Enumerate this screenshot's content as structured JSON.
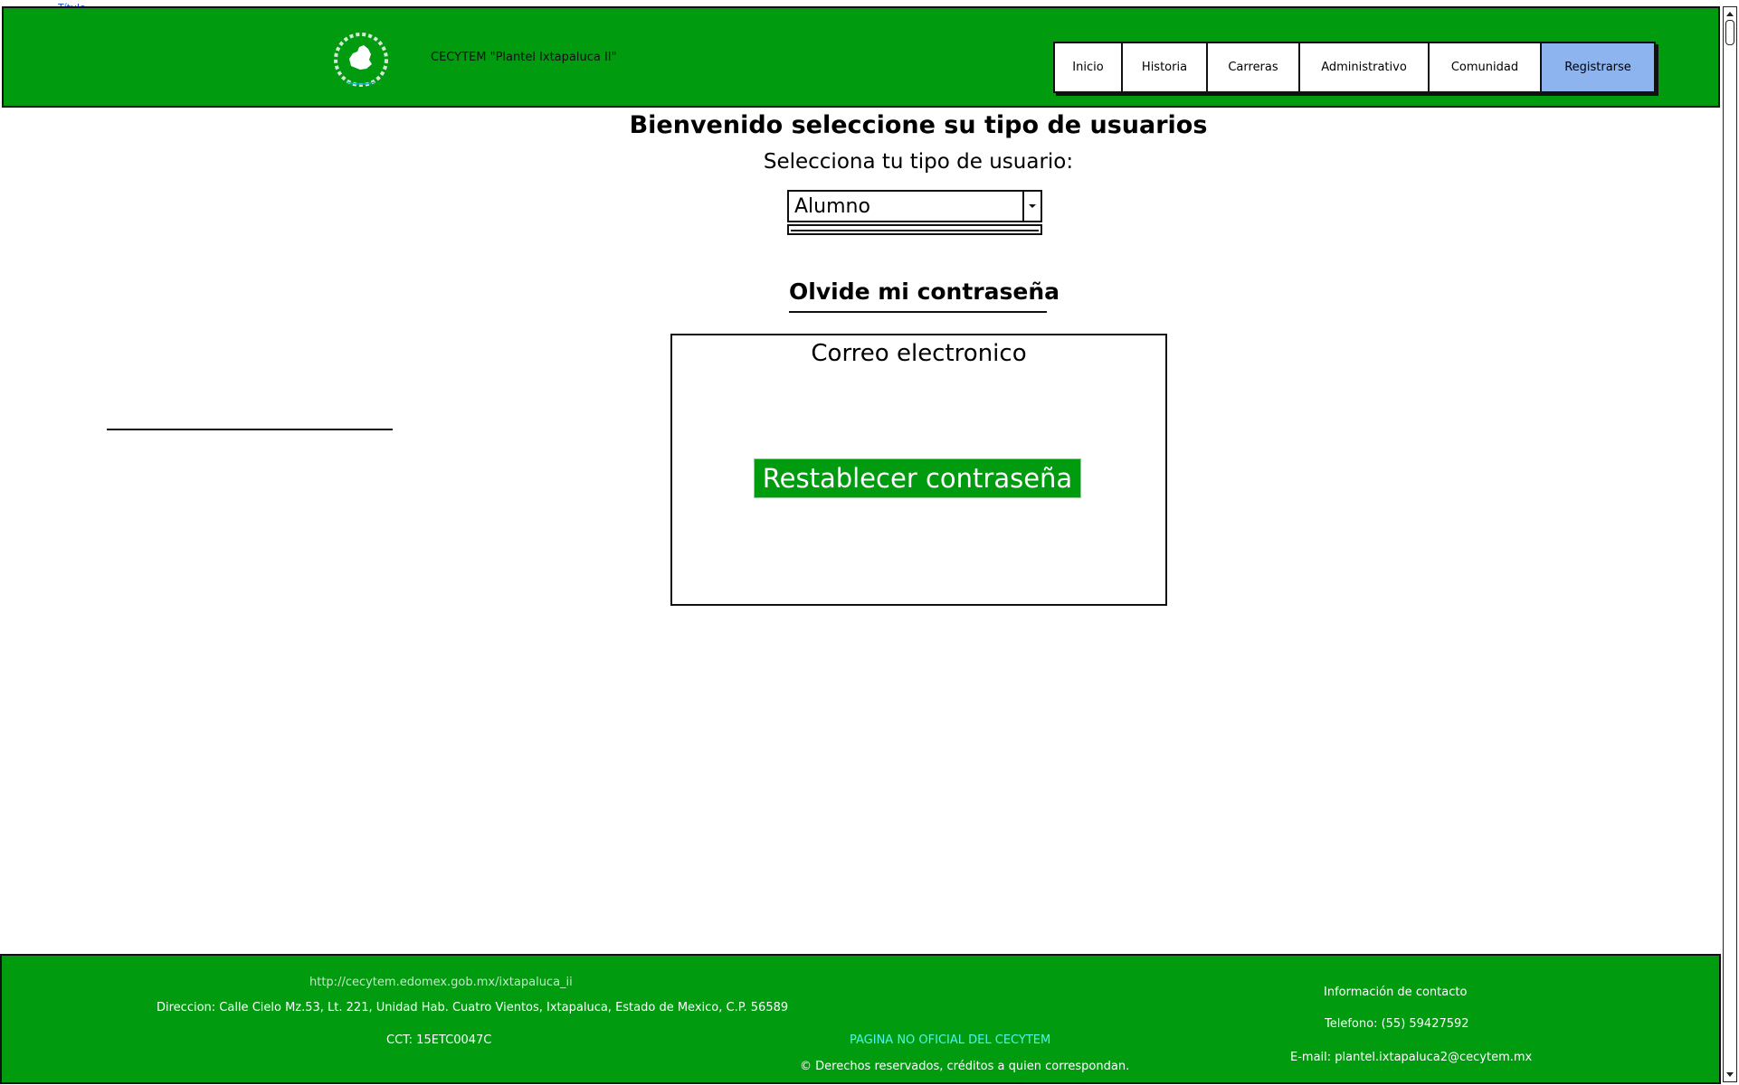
{
  "top_link": "Título",
  "header": {
    "title": "CECYTEM \"Plantel Ixtapaluca II\"",
    "logo_icon": "state-map-seal-icon",
    "nav": [
      {
        "label": "Inicio",
        "active": false
      },
      {
        "label": "Historia",
        "active": false
      },
      {
        "label": "Carreras",
        "active": false
      },
      {
        "label": "Administrativo",
        "active": false
      },
      {
        "label": "Comunidad",
        "active": false
      },
      {
        "label": "Registrarse",
        "active": true
      }
    ]
  },
  "main": {
    "welcome": "Bienvenido seleccione su tipo de usuarios",
    "select_label": "Selecciona tu tipo de usuario:",
    "user_type": "Alumno",
    "forgot_heading": "Olvide mi contraseña",
    "card": {
      "title": "Correo electronico",
      "email_value": "",
      "reset_label": "Restablecer contraseña"
    }
  },
  "footer": {
    "url": "http://cecytem.edomex.gob.mx/ixtapaluca_ii",
    "address": "Direccion: Calle Cielo Mz.53, Lt. 221, Unidad Hab. Cuatro Vientos, Ixtapaluca, Estado de Mexico, C.P. 56589",
    "cct": "CCT: 15ETC0047C",
    "unofficial": "PAGINA NO OFICIAL DEL CECYTEM",
    "rights": "© Derechos reservados, créditos a quien correspondan.",
    "contact_heading": "Información de contacto",
    "phone": "Telefono: (55) 59427592",
    "email": "E-mail: plantel.ixtapaluca2@cecytem.mx"
  },
  "colors": {
    "brand_green": "#009b0f",
    "active_nav": "#8db4ef",
    "unofficial_text": "#4ff5e8"
  }
}
